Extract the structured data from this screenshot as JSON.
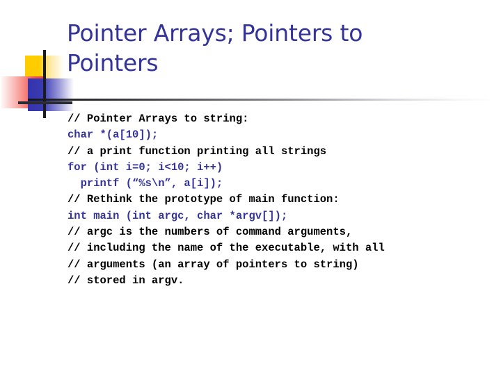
{
  "slide": {
    "title": "Pointer Arrays; Pointers to Pointers",
    "title_color": "#333399",
    "background": "#ffffff"
  },
  "logo": {
    "yellow": "#ffcc00",
    "red": "#f0453c",
    "blue": "#3333aa",
    "line": "#1a1a22"
  },
  "rule": {
    "start_color": "#141418",
    "end_color": "#ffffff"
  },
  "code": {
    "comment_color": "#000000",
    "code_color": "#333399",
    "lines": [
      {
        "text": "// Pointer Arrays to string:",
        "kind": "comment"
      },
      {
        "text": "char *(a[10]);",
        "kind": "code"
      },
      {
        "text": "// a print function printing all strings",
        "kind": "comment"
      },
      {
        "text": "for (int i=0; i<10; i++)",
        "kind": "code"
      },
      {
        "text": "  printf (“%s\\n”, a[i]);",
        "kind": "code"
      },
      {
        "text": "// Rethink the prototype of main function:",
        "kind": "comment"
      },
      {
        "text": "int main (int argc, char *argv[]);",
        "kind": "code"
      },
      {
        "text": "// argc is the numbers of command arguments,",
        "kind": "comment"
      },
      {
        "text": "// including the name of the executable, with all",
        "kind": "comment"
      },
      {
        "text": "// arguments (an array of pointers to string)",
        "kind": "comment"
      },
      {
        "text": "// stored in argv.",
        "kind": "comment"
      }
    ]
  }
}
